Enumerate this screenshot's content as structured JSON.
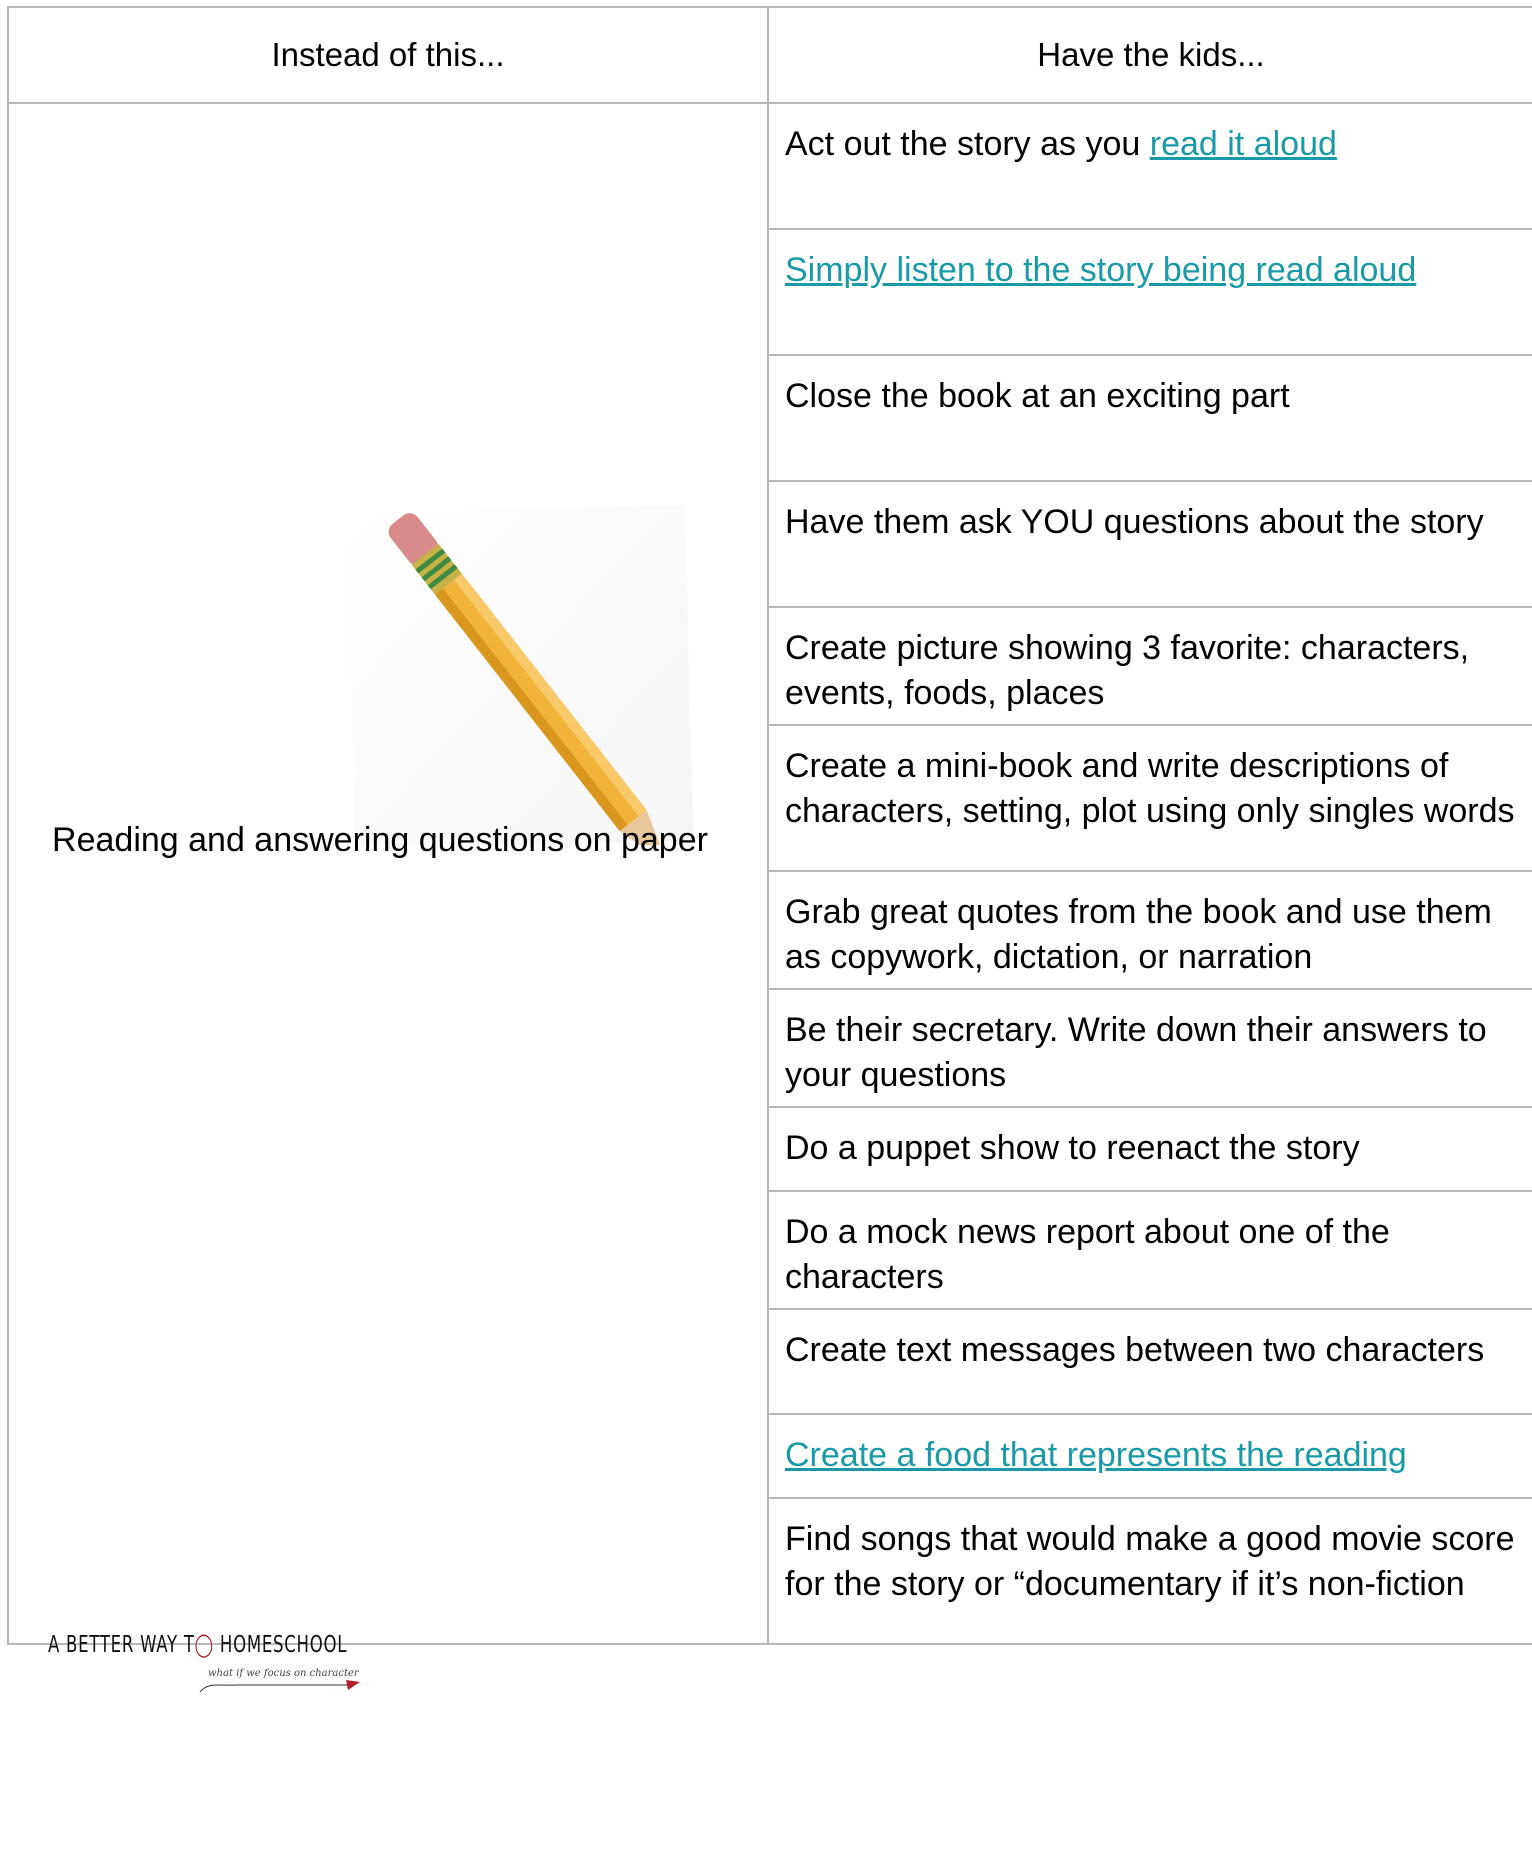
{
  "header": {
    "left": "Instead of this...",
    "right": "Have the kids..."
  },
  "left": {
    "text": "Reading and answering questions on paper",
    "image": "pencil-image",
    "logo": {
      "main_prefix": "A BETTER WAY T",
      "main_suffix": " HOMESCHOOL",
      "tagline": "what if we focus on character"
    }
  },
  "rows": [
    {
      "prefix": "Act out the story as you ",
      "link": "read it aloud",
      "suffix": ""
    },
    {
      "prefix": "",
      "link": "Simply listen to the story being read aloud",
      "suffix": ""
    },
    {
      "prefix": "Close the book at an exciting part",
      "link": "",
      "suffix": ""
    },
    {
      "prefix": "Have them ask YOU questions about the story",
      "link": "",
      "suffix": ""
    },
    {
      "prefix": "Create picture showing  3 favorite: characters, events, foods, places",
      "link": "",
      "suffix": ""
    },
    {
      "prefix": "Create a mini-book and write descriptions of characters, setting, plot using only singles words",
      "link": "",
      "suffix": ""
    },
    {
      "prefix": "Grab great quotes from the book and use them as copywork, dictation, or narration",
      "link": "",
      "suffix": ""
    },
    {
      "prefix": "Be their secretary. Write down their answers to your questions",
      "link": "",
      "suffix": ""
    },
    {
      "prefix": "Do a puppet show to reenact the story",
      "link": "",
      "suffix": ""
    },
    {
      "prefix": "Do a mock news report about one of the characters",
      "link": "",
      "suffix": ""
    },
    {
      "prefix": "Create text messages between two characters",
      "link": "",
      "suffix": ""
    },
    {
      "prefix": "",
      "link": "Create a food that represents the reading",
      "suffix": ""
    },
    {
      "prefix": "Find songs that would make a good movie score for the story or “documentary if it’s non-fiction",
      "link": "",
      "suffix": ""
    }
  ],
  "colors": {
    "link": "#1a9aa8",
    "border": "#b7b7b7",
    "pencil_body": "#f2b33a",
    "logo_accent": "#b0202a"
  }
}
